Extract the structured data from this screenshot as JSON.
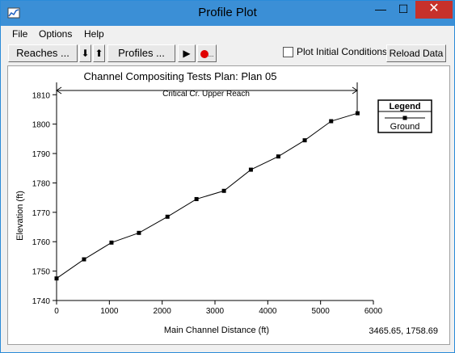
{
  "window": {
    "title": "Profile Plot",
    "minimize_glyph": "—",
    "maximize_glyph": "☐",
    "close_glyph": "✕"
  },
  "menu": {
    "items": [
      {
        "label": "File"
      },
      {
        "label": "Options"
      },
      {
        "label": "Help"
      }
    ]
  },
  "toolbar": {
    "reaches_label": "Reaches ...",
    "down_glyph": "⬇",
    "up_glyph": "⬆",
    "profiles_label": "Profiles ...",
    "play_glyph": "▶",
    "record_dots": "...",
    "plot_initial_label": "Plot Initial Conditions",
    "plot_initial_checked": false,
    "reload_label": "Reload Data"
  },
  "plot": {
    "title": "Channel Compositing Tests     Plan: Plan 05",
    "reach_label": "Critical Cr. Upper Reach",
    "coordinate_readout": "3465.65, 1758.69"
  },
  "chart_data": {
    "type": "line",
    "title": "Channel Compositing Tests     Plan: Plan 05",
    "xlabel": "Main Channel Distance (ft)",
    "ylabel": "Elevation (ft)",
    "xlim": [
      0,
      6000
    ],
    "ylim": [
      1740,
      1812
    ],
    "xticks": [
      "0",
      "1000",
      "2000",
      "3000",
      "4000",
      "5000",
      "6000"
    ],
    "yticks": [
      "1740",
      "1750",
      "1760",
      "1770",
      "1780",
      "1790",
      "1800",
      "1810"
    ],
    "grid": false,
    "legend_title": "Legend",
    "legend_position": "top-right",
    "series": [
      {
        "name": "Ground",
        "color": "#000000",
        "marker": "square",
        "x": [
          0,
          520,
          1040,
          1560,
          2100,
          2650,
          3170,
          3680,
          4200,
          4700,
          5200,
          5700
        ],
        "y": [
          1747.5,
          1754,
          1759.7,
          1763,
          1768.5,
          1774.5,
          1777.3,
          1784.5,
          1789,
          1794.5,
          1801,
          1803.7
        ]
      }
    ]
  }
}
